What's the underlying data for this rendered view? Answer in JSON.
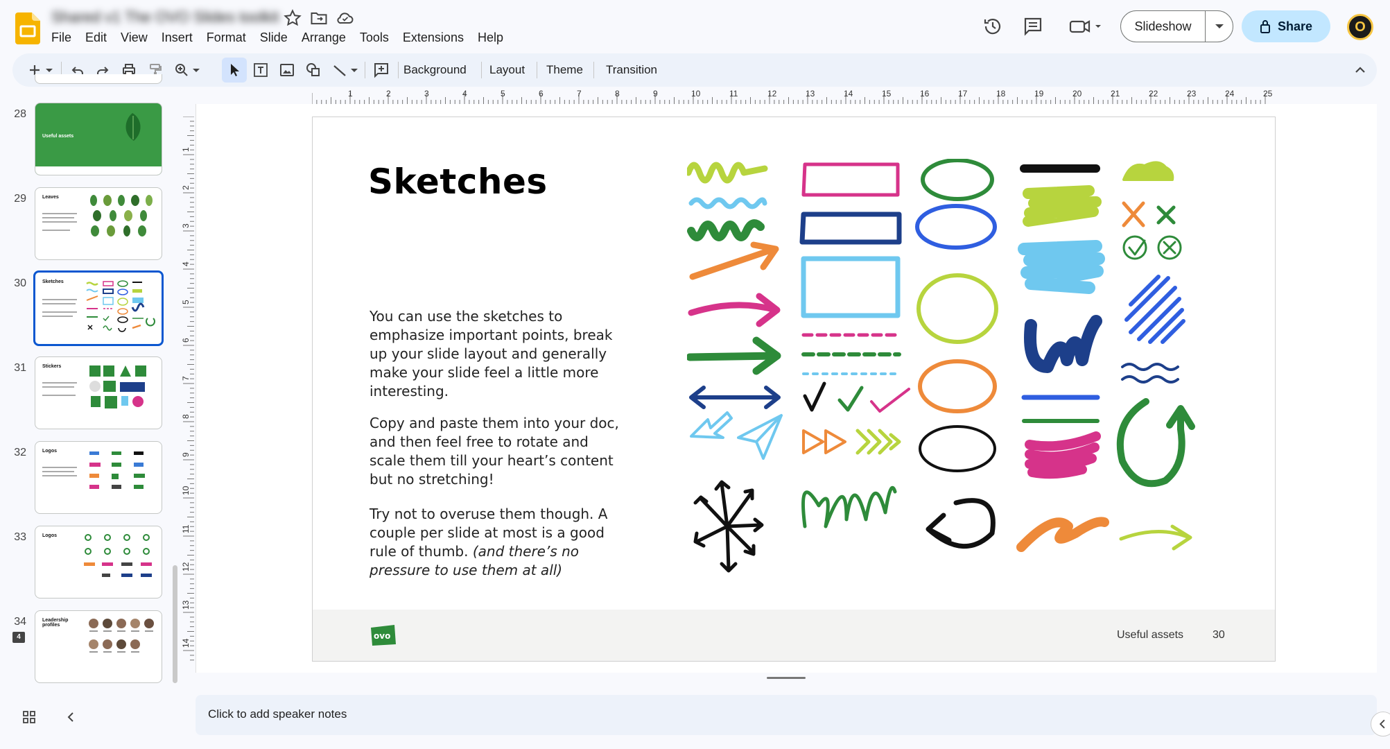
{
  "document": {
    "title": "Shared v1 The OVO Slides toolkit"
  },
  "menu": [
    "File",
    "Edit",
    "View",
    "Insert",
    "Format",
    "Slide",
    "Arrange",
    "Tools",
    "Extensions",
    "Help"
  ],
  "header": {
    "slideshow_label": "Slideshow",
    "share_label": "Share",
    "avatar_initial": "O"
  },
  "toolbar": {
    "background_label": "Background",
    "layout_label": "Layout",
    "theme_label": "Theme",
    "transition_label": "Transition"
  },
  "filmstrip": {
    "slides": [
      {
        "number": "28",
        "title": "Useful assets"
      },
      {
        "number": "29",
        "title": "Leaves"
      },
      {
        "number": "30",
        "title": "Sketches",
        "selected": true
      },
      {
        "number": "31",
        "title": "Stickers"
      },
      {
        "number": "32",
        "title": "Logos"
      },
      {
        "number": "33",
        "title": "Logos"
      },
      {
        "number": "34",
        "title": "Leadership profiles",
        "comments": "4"
      }
    ]
  },
  "ruler": {
    "horizontal": [
      "1",
      "2",
      "3",
      "4",
      "5",
      "6",
      "7",
      "8",
      "9",
      "10",
      "11",
      "12",
      "13",
      "14",
      "15",
      "16",
      "17",
      "18",
      "19",
      "20",
      "21",
      "22",
      "23",
      "24",
      "25"
    ],
    "vertical": [
      "1",
      "2",
      "3",
      "4",
      "5",
      "6",
      "7",
      "8",
      "9",
      "10",
      "11",
      "12",
      "13",
      "14"
    ]
  },
  "slide": {
    "title": "Sketches",
    "para1": "You can use the sketches to emphasize important points, break up your slide layout and generally make your slide feel a little more interesting.",
    "para2": "Copy and paste them into your doc, and then feel free to rotate and scale them till your heart’s content but no stretching!",
    "para3_plain": "Try not to overuse them though. A couple per slide at most is a good rule of thumb. ",
    "para3_italic": "(and there’s no pressure to use them at all)",
    "footer_label": "Useful assets",
    "footer_page": "30"
  },
  "notes": {
    "placeholder": "Click to add speaker notes"
  },
  "colors": {
    "accent": "#0b57d0",
    "share_bg": "#c2e7ff",
    "ovo_green": "#2e8b3a",
    "pink": "#d6338a",
    "navy": "#1d3f8a",
    "sky": "#6fc8ef",
    "lime": "#b7d43e",
    "orange": "#ee8a3a",
    "blue": "#2f5ee0"
  }
}
